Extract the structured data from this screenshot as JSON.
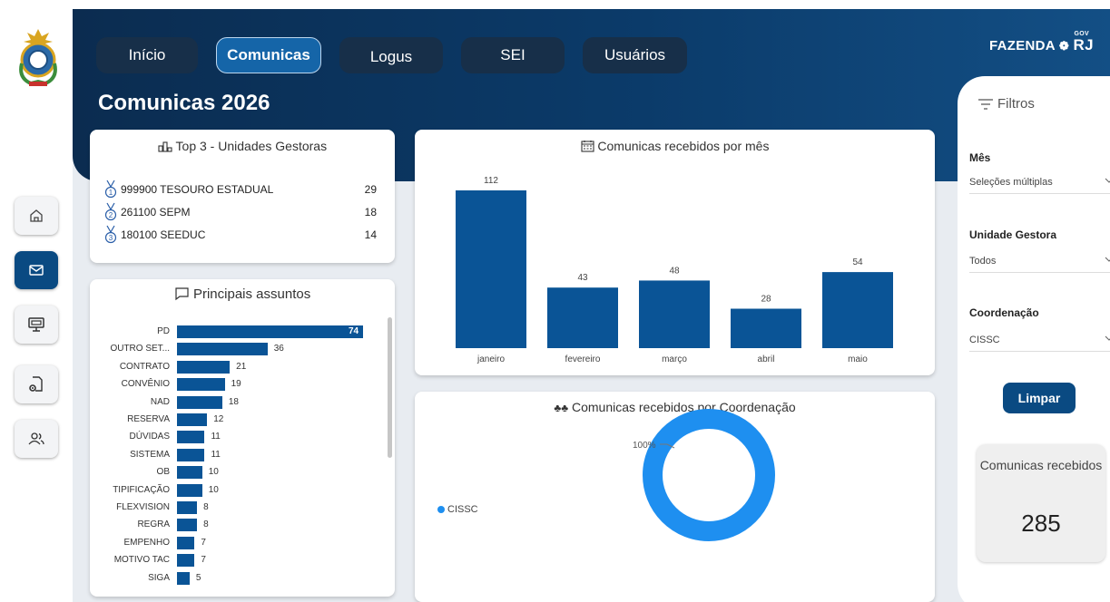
{
  "header": {
    "page_title": "Comunicas 2026",
    "brand_text": "FAZENDA",
    "brand_suffix": "RJ",
    "brand_gov": "GOV",
    "tabs": [
      {
        "label": "Início",
        "active": false
      },
      {
        "label": "Comunicas",
        "active": true
      },
      {
        "label": "Logus",
        "active": false
      },
      {
        "label": "SEI",
        "active": false
      },
      {
        "label": "Usuários",
        "active": false
      }
    ]
  },
  "sidebar": {
    "items": [
      {
        "icon": "home-icon",
        "active": false
      },
      {
        "icon": "mail-icon",
        "active": true
      },
      {
        "icon": "monitor-icon",
        "active": false
      },
      {
        "icon": "document-settings-icon",
        "active": false
      },
      {
        "icon": "users-icon",
        "active": false
      }
    ]
  },
  "top3": {
    "title": "Top 3 - Unidades Gestoras",
    "rows": [
      {
        "rank": "1",
        "label": "999900 TESOURO ESTADUAL",
        "value": "29"
      },
      {
        "rank": "2",
        "label": "261100 SEPM",
        "value": "18"
      },
      {
        "rank": "3",
        "label": "180100 SEEDUC",
        "value": "14"
      }
    ]
  },
  "subjects": {
    "title": "Principais assuntos",
    "chart_data": {
      "type": "bar",
      "orientation": "horizontal",
      "categories": [
        "PD",
        "OUTRO SET...",
        "CONTRATO",
        "CONVÊNIO",
        "NAD",
        "RESERVA",
        "DÚVIDAS",
        "SISTEMA",
        "OB",
        "TIPIFICAÇÃO",
        "FLEXVISION",
        "REGRA",
        "EMPENHO",
        "MOTIVO TAC",
        "SIGA"
      ],
      "values": [
        74,
        36,
        21,
        19,
        18,
        12,
        11,
        11,
        10,
        10,
        8,
        8,
        7,
        7,
        5
      ],
      "labels": [
        "74",
        "36",
        "21",
        "19",
        "18",
        "12",
        "11",
        "11",
        "10",
        "10",
        "8",
        "8",
        "7",
        "7",
        "5"
      ]
    }
  },
  "monthly": {
    "title": "Comunicas recebidos por mês",
    "chart_data": {
      "type": "bar",
      "categories": [
        "janeiro",
        "fevereiro",
        "março",
        "abril",
        "maio"
      ],
      "values": [
        112,
        43,
        48,
        28,
        54
      ],
      "labels": [
        "112",
        "43",
        "48",
        "28",
        "54"
      ],
      "color": "#0a5496"
    }
  },
  "coordination": {
    "title": "Comunicas recebidos por Coordenação",
    "chart_data": {
      "type": "pie",
      "categories": [
        "CISSC"
      ],
      "values": [
        100
      ],
      "label": "100%",
      "color": "#1e8ff0"
    }
  },
  "filters": {
    "title": "Filtros",
    "month_label": "Mês",
    "month_value": "Seleções múltiplas",
    "unit_label": "Unidade Gestora",
    "unit_value": "Todos",
    "coord_label": "Coordenação",
    "coord_value": "CISSC",
    "clear_label": "Limpar"
  },
  "kpi": {
    "label": "Comunicas recebidos",
    "value": "285"
  }
}
